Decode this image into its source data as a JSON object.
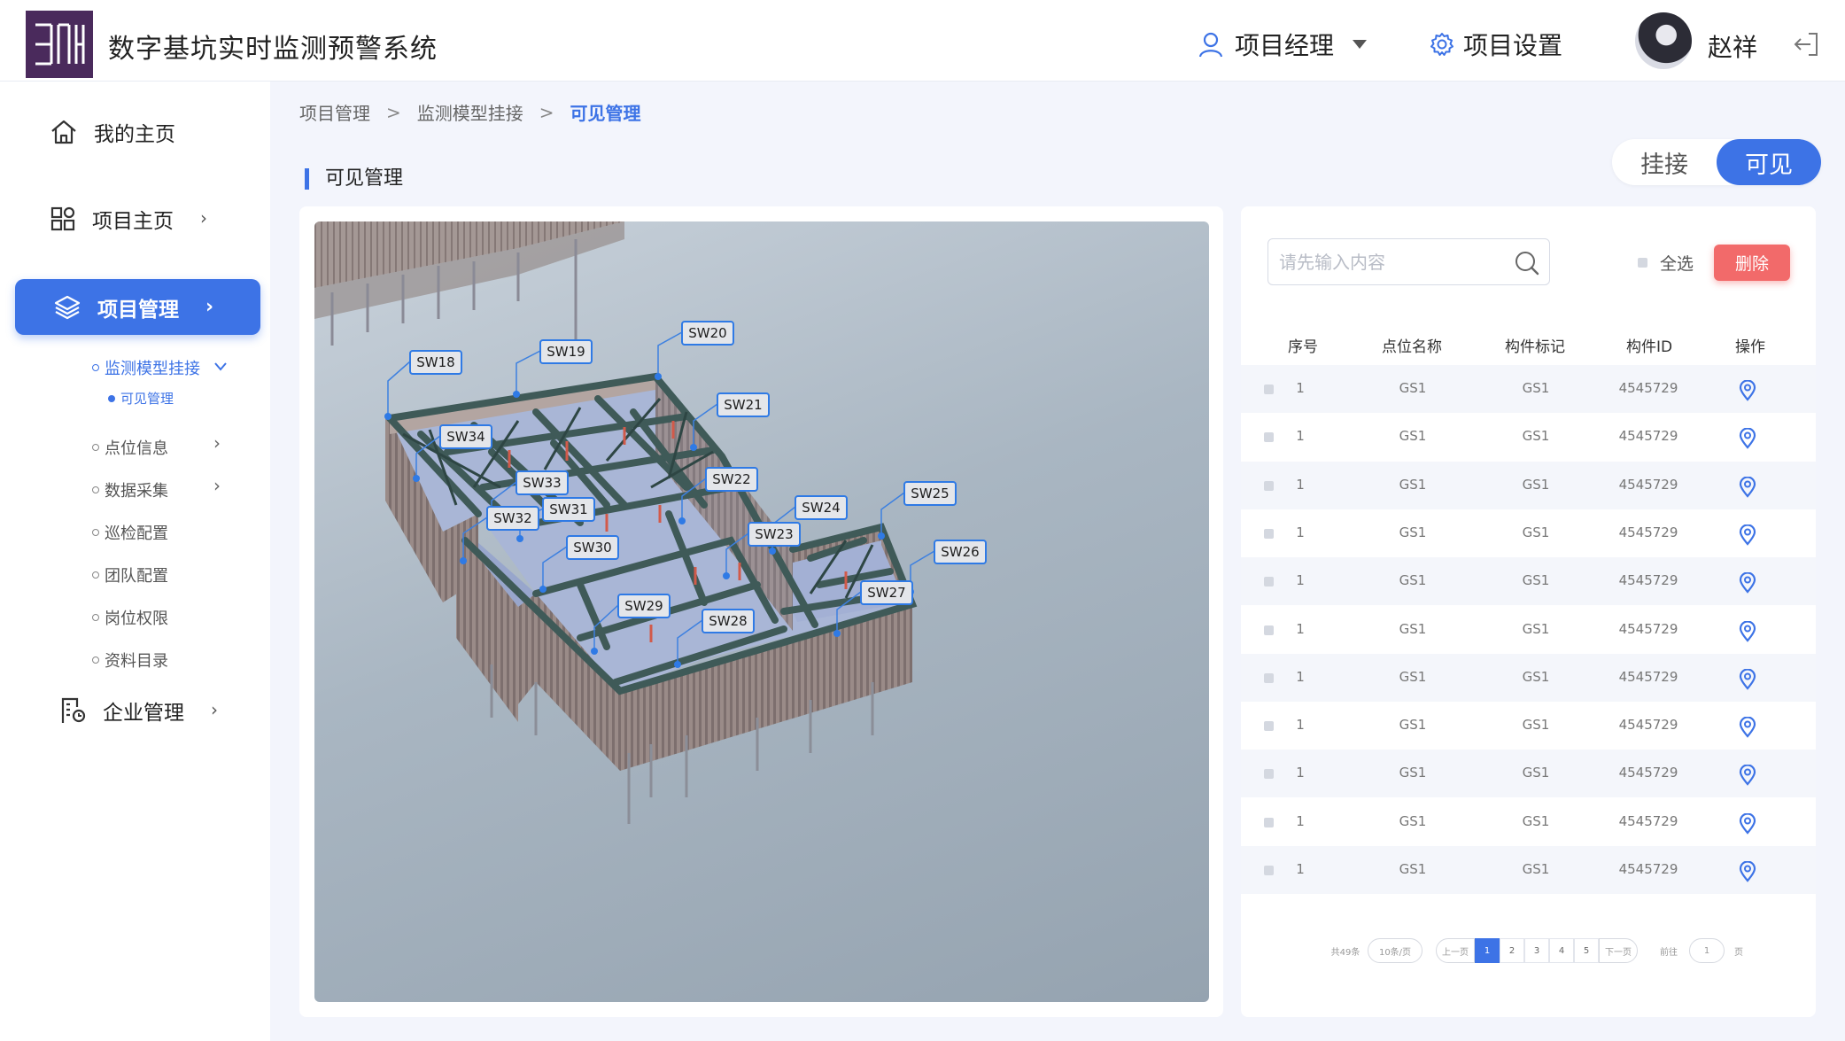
{
  "app": {
    "title": "数字基坑实时监测预警系统"
  },
  "header": {
    "role_label": "项目经理",
    "settings_label": "项目设置",
    "user_name": "赵祥"
  },
  "sidebar": {
    "items": [
      {
        "label": "我的主页"
      },
      {
        "label": "项目主页"
      },
      {
        "label": "项目管理"
      },
      {
        "label": "企业管理"
      }
    ],
    "subitems": [
      {
        "label": "监测模型挂接"
      },
      {
        "label": "可见管理"
      },
      {
        "label": "点位信息"
      },
      {
        "label": "数据采集"
      },
      {
        "label": "巡检配置"
      },
      {
        "label": "团队配置"
      },
      {
        "label": "岗位权限"
      },
      {
        "label": "资料目录"
      }
    ]
  },
  "breadcrumb": [
    "项目管理",
    "监测模型挂接",
    "可见管理"
  ],
  "section_title": "可见管理",
  "toggle": {
    "option1": "挂接",
    "option2": "可见"
  },
  "model": {
    "labels": [
      "SW18",
      "SW19",
      "SW20",
      "SW21",
      "SW22",
      "SW23",
      "SW24",
      "SW25",
      "SW26",
      "SW27",
      "SW28",
      "SW29",
      "SW30",
      "SW31",
      "SW32",
      "SW33",
      "SW34"
    ]
  },
  "table": {
    "search_placeholder": "请先输入内容",
    "select_all": "全选",
    "delete_label": "删除",
    "headers": [
      "序号",
      "点位名称",
      "构件标记",
      "构件ID",
      "操作"
    ],
    "rows": [
      {
        "no": "1",
        "name": "GS1",
        "mark": "GS1",
        "id": "4545729"
      },
      {
        "no": "1",
        "name": "GS1",
        "mark": "GS1",
        "id": "4545729"
      },
      {
        "no": "1",
        "name": "GS1",
        "mark": "GS1",
        "id": "4545729"
      },
      {
        "no": "1",
        "name": "GS1",
        "mark": "GS1",
        "id": "4545729"
      },
      {
        "no": "1",
        "name": "GS1",
        "mark": "GS1",
        "id": "4545729"
      },
      {
        "no": "1",
        "name": "GS1",
        "mark": "GS1",
        "id": "4545729"
      },
      {
        "no": "1",
        "name": "GS1",
        "mark": "GS1",
        "id": "4545729"
      },
      {
        "no": "1",
        "name": "GS1",
        "mark": "GS1",
        "id": "4545729"
      },
      {
        "no": "1",
        "name": "GS1",
        "mark": "GS1",
        "id": "4545729"
      },
      {
        "no": "1",
        "name": "GS1",
        "mark": "GS1",
        "id": "4545729"
      },
      {
        "no": "1",
        "name": "GS1",
        "mark": "GS1",
        "id": "4545729"
      }
    ]
  },
  "pagination": {
    "total": "共49条",
    "page_size": "10条/页",
    "prev": "上一页",
    "pages": [
      "1",
      "2",
      "3",
      "4",
      "5"
    ],
    "current": "1",
    "next": "下一页",
    "goto_label": "前往",
    "goto_value": "1",
    "page_suffix": "页"
  },
  "colors": {
    "accent": "#3d73e6",
    "danger": "#f26a6a",
    "pin": "#3d73e6"
  }
}
